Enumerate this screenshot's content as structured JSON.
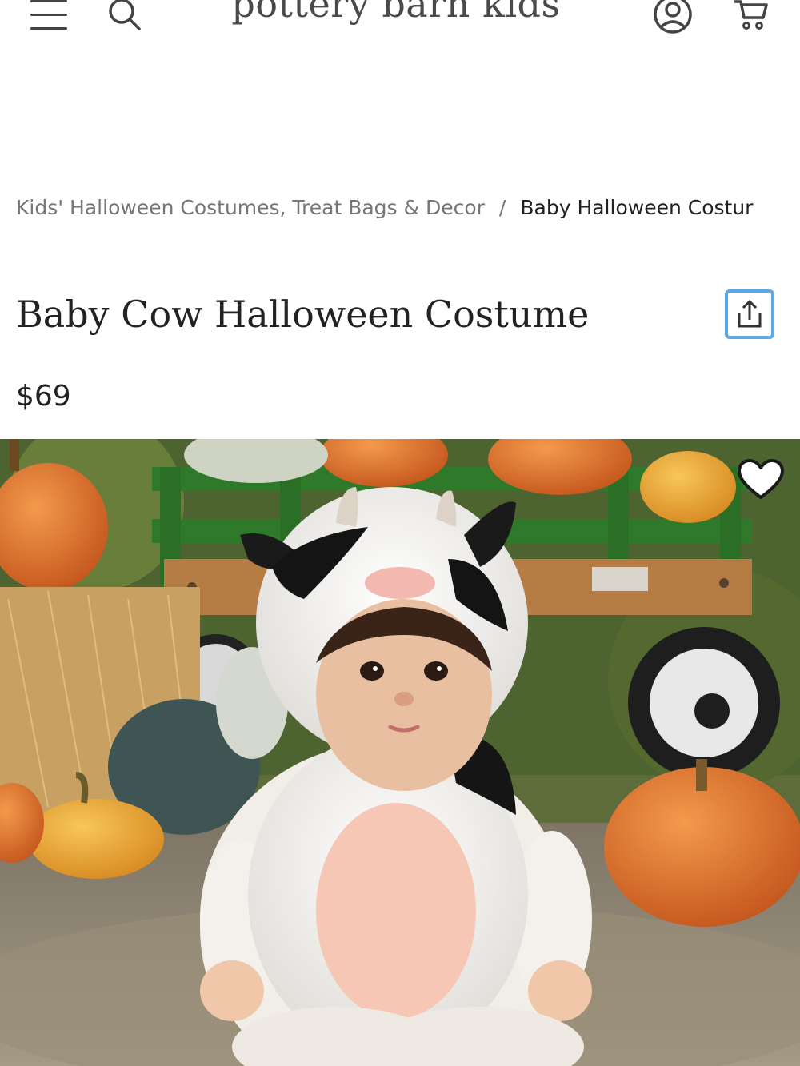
{
  "header": {
    "logo": "pottery barn kids",
    "icons": {
      "menu": "hamburger-menu-icon",
      "search": "search-icon",
      "account": "user-account-icon",
      "cart": "shopping-cart-icon"
    }
  },
  "breadcrumb": {
    "parent": "Kids' Halloween Costumes, Treat Bags & Decor",
    "separator": "/",
    "current": "Baby Halloween Costur"
  },
  "product": {
    "title": "Baby Cow Halloween Costume",
    "price": "$69",
    "share_icon": "share-upload-icon",
    "wishlist_icon": "heart-icon"
  },
  "colors": {
    "accent_share_border": "#5aa9e6",
    "text_primary": "#222222",
    "text_muted": "#767676"
  }
}
